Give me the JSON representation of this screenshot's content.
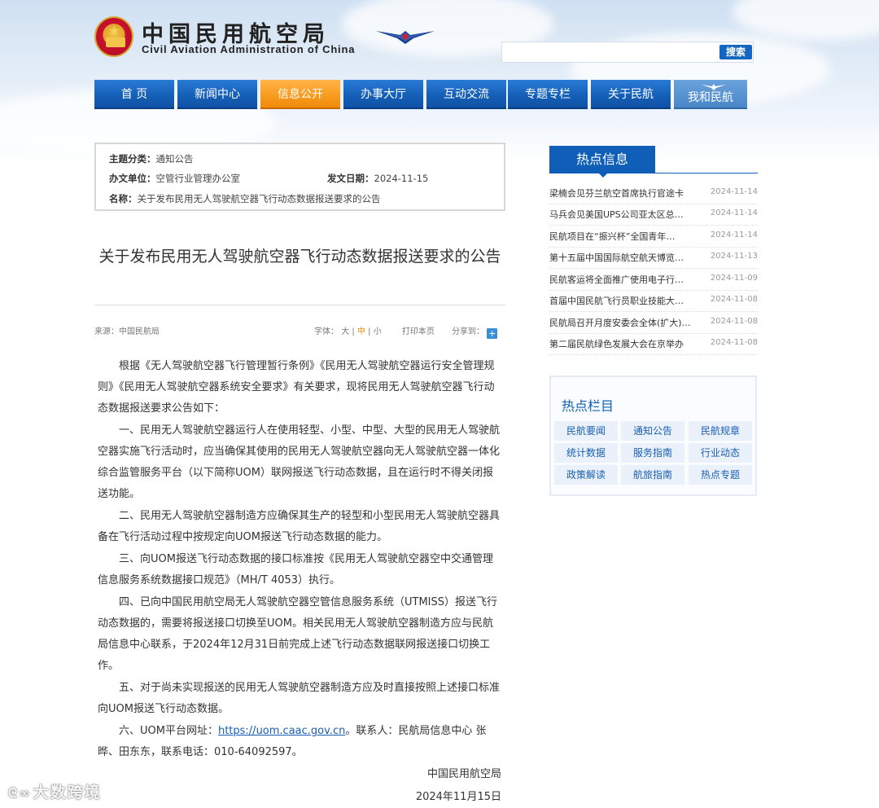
{
  "site": {
    "title_cn": "中国民用航空局",
    "title_en": "Civil Aviation Administration of China",
    "search_placeholder": "",
    "search_button": "搜索"
  },
  "nav": [
    "首 页",
    "新闻中心",
    "信息公开",
    "办事大厅",
    "互动交流",
    "专题专栏",
    "关于民航",
    "我和民航"
  ],
  "nav_active": 2,
  "meta": {
    "category_label": "主题分类：",
    "category": "通知公告",
    "issuer_label": "办文单位：",
    "issuer": "空管行业管理办公室",
    "date_label": "发文日期：",
    "date": "2024-11-15",
    "name_label": "名称：",
    "name": "关于发布民用无人驾驶航空器飞行动态数据报送要求的公告"
  },
  "article": {
    "title": "关于发布民用无人驾驶航空器飞行动态数据报送要求的公告",
    "source": "来源：中国民航局",
    "font_label": "字体：",
    "font_large": "大",
    "font_medium": "中",
    "font_small": "小",
    "print": "打印本页",
    "share_label": "分享到：",
    "paragraphs": [
      "根据《无人驾驶航空器飞行管理暂行条例》《民用无人驾驶航空器运行安全管理规则》《民用无人驾驶航空器系统安全要求》有关要求，现将民用无人驾驶航空器飞行动态数据报送要求公告如下：",
      "一、民用无人驾驶航空器运行人在使用轻型、小型、中型、大型的民用无人驾驶航空器实施飞行活动时，应当确保其使用的民用无人驾驶航空器向无人驾驶航空器一体化综合监管服务平台（以下简称UOM）联网报送飞行动态数据，且在运行时不得关闭报送功能。",
      "二、民用无人驾驶航空器制造方应确保其生产的轻型和小型民用无人驾驶航空器具备在飞行活动过程中按规定向UOM报送飞行动态数据的能力。",
      "三、向UOM报送飞行动态数据的接口标准按《民用无人驾驶航空器空中交通管理信息服务系统数据接口规范》（MH/T 4053）执行。",
      "四、已向中国民用航空局无人驾驶航空器空管信息服务系统（UTMISS）报送飞行动态数据的，需要将报送接口切换至UOM。相关民用无人驾驶航空器制造方应与民航局信息中心联系，于2024年12月31日前完成上述飞行动态数据联网报送接口切换工作。",
      "五、对于尚未实现报送的民用无人驾驶航空器制造方应及时直接按照上述接口标准向UOM报送飞行动态数据。"
    ],
    "p6_before": "六、UOM平台网址：",
    "p6_link": "https://uom.caac.gov.cn",
    "p6_after": "。联系人：民航局信息中心 张晔、田东东，联系电话：010-64092597。",
    "sign_org": "中国民用航空局",
    "sign_date": "2024年11月15日"
  },
  "hot": {
    "title": "热点信息",
    "items": [
      {
        "title": "梁楠会见芬兰航空首席执行官途卡",
        "date": "2024-11-14"
      },
      {
        "title": "马兵会见美国UPS公司亚太区总…",
        "date": "2024-11-14"
      },
      {
        "title": "民航项目在“振兴杯”全国青年…",
        "date": "2024-11-14"
      },
      {
        "title": "第十五届中国国际航空航天博览…",
        "date": "2024-11-13"
      },
      {
        "title": "民航客运将全面推广使用电子行…",
        "date": "2024-11-09"
      },
      {
        "title": "首届中国民航飞行员职业技能大…",
        "date": "2024-11-08"
      },
      {
        "title": "民航局召开月度安委会全体(扩大)…",
        "date": "2024-11-08"
      },
      {
        "title": "第二届民航绿色发展大会在京举办",
        "date": "2024-11-08"
      }
    ]
  },
  "columns": {
    "title": "热点栏目",
    "cells": [
      "民航要闻",
      "通知公告",
      "民航规章",
      "统计数据",
      "服务指南",
      "行业动态",
      "政策解读",
      "航旅指南",
      "热点专题"
    ]
  },
  "watermark": "大数跨境",
  "colors": {
    "nav_blue": "#1560b8",
    "nav_active": "#f79a1e",
    "link": "#1a5fb4"
  }
}
